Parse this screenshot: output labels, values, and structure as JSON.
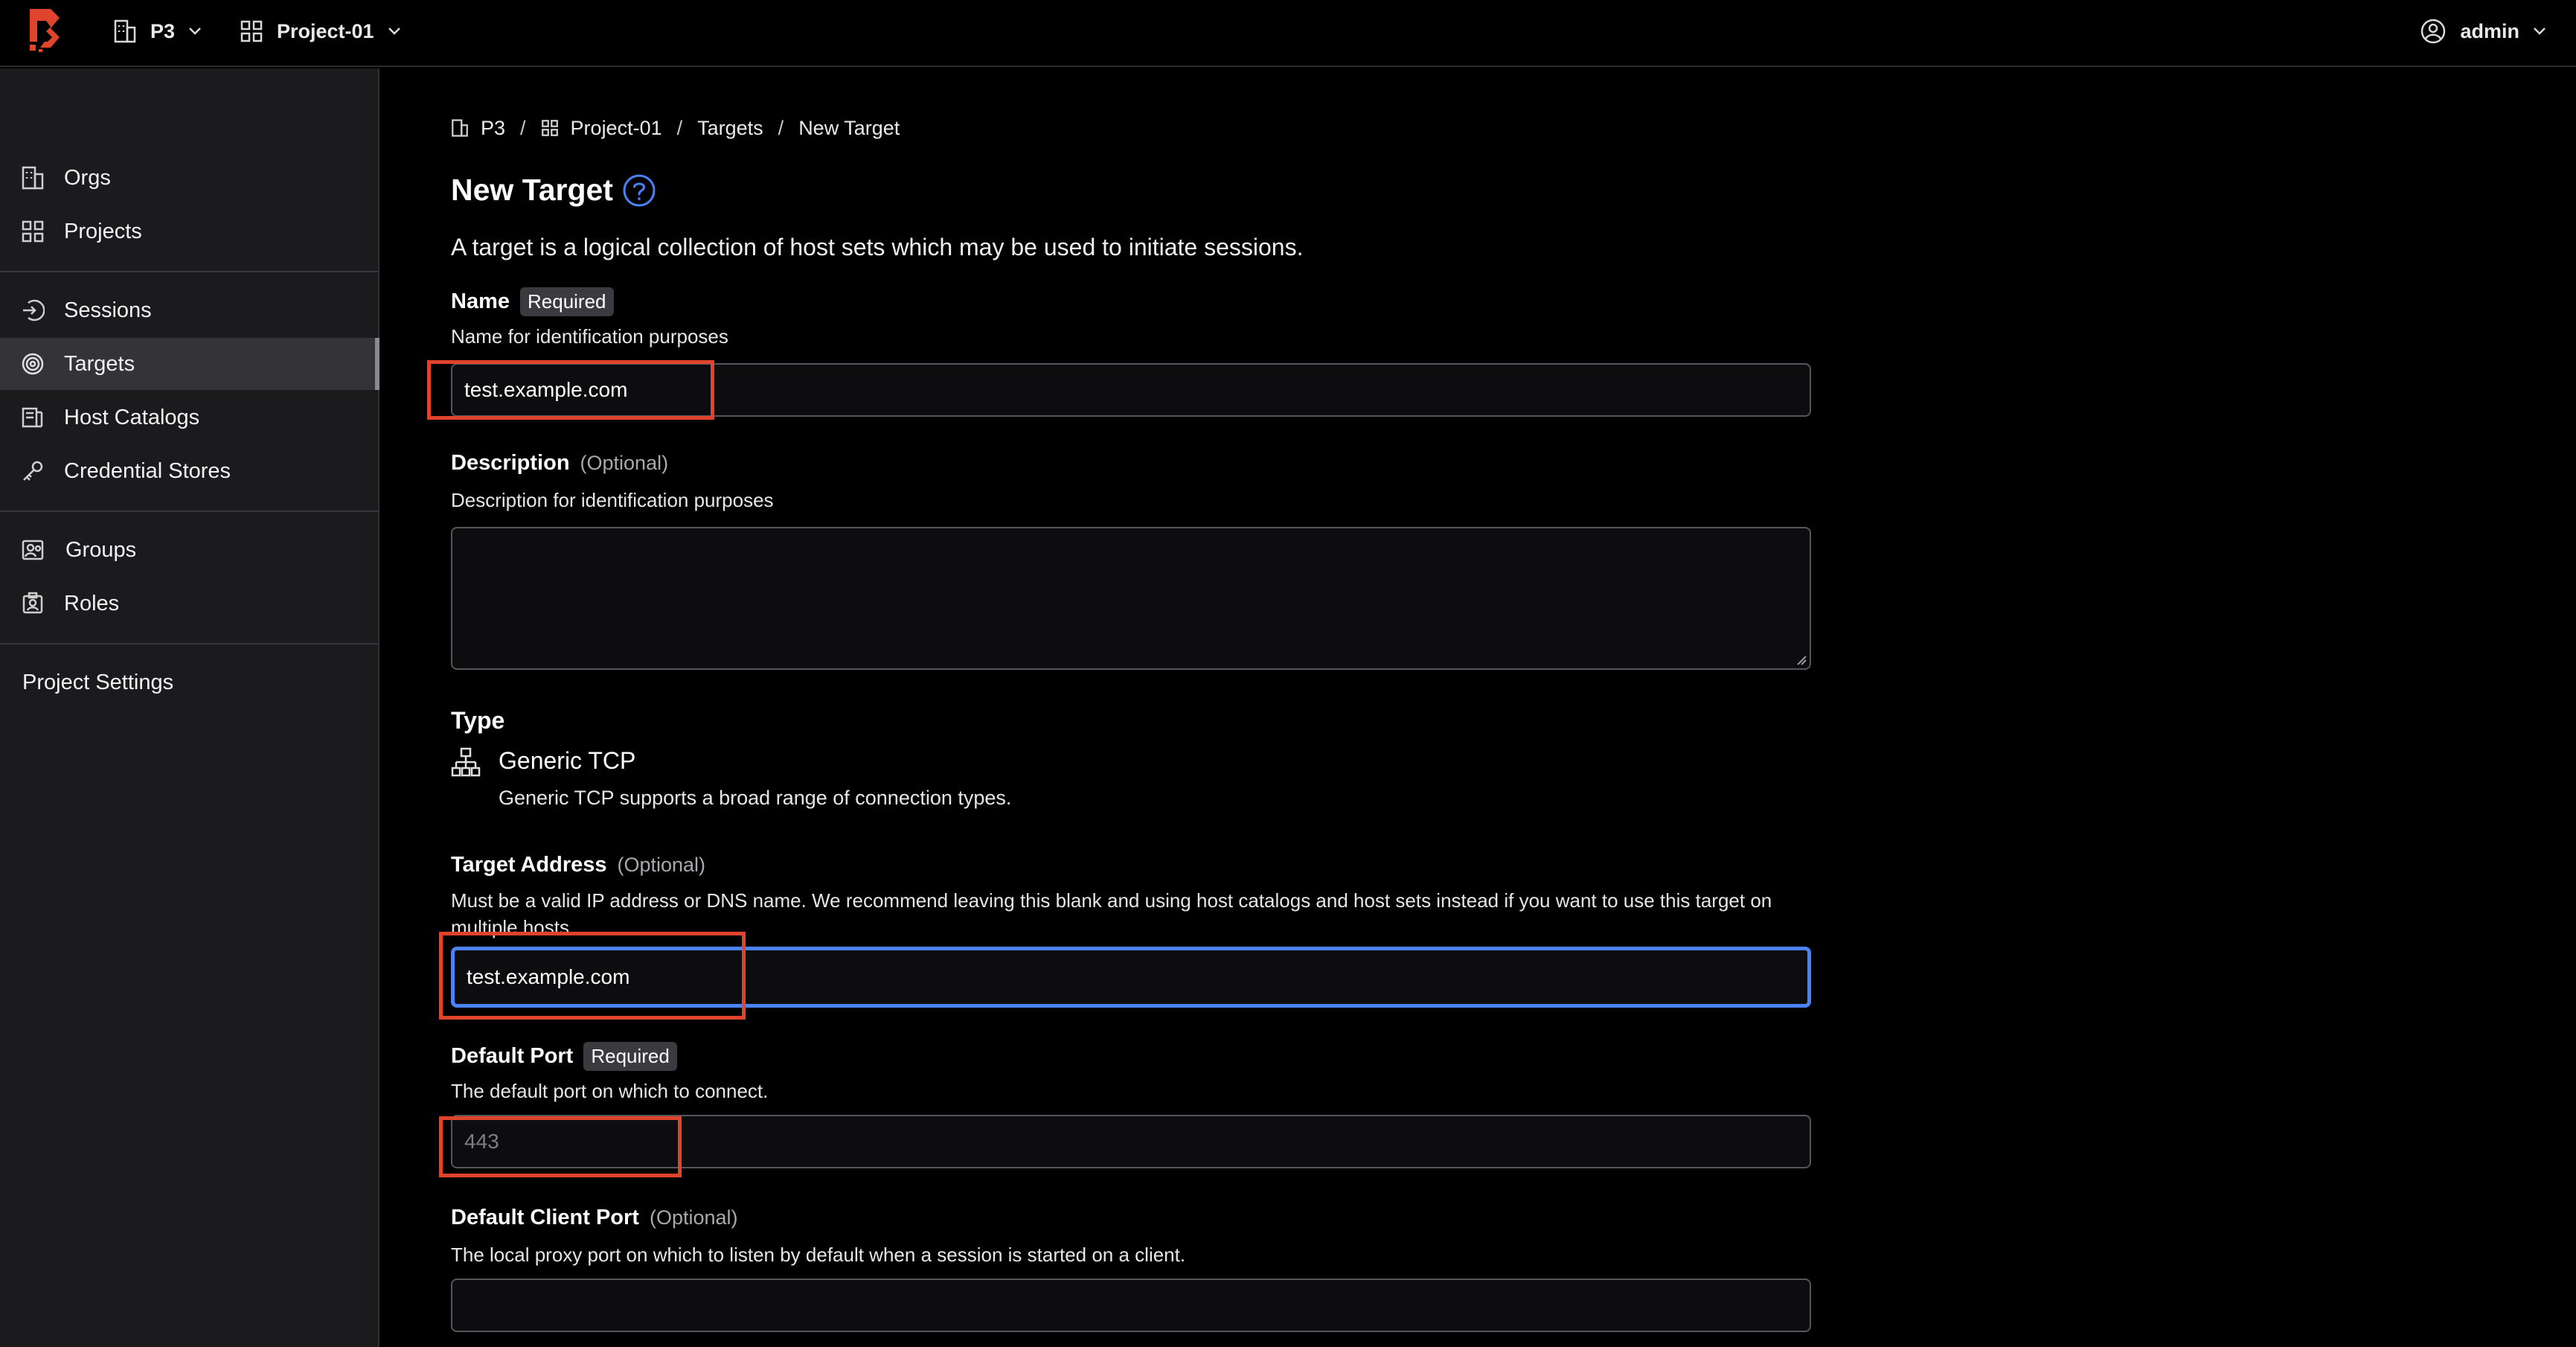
{
  "topbar": {
    "org": "P3",
    "project": "Project-01",
    "user": "admin",
    "brand_color": "#e0442c"
  },
  "sidebar": {
    "items": [
      {
        "label": "Orgs",
        "icon": "building-icon"
      },
      {
        "label": "Projects",
        "icon": "grid-icon"
      },
      {
        "label": "Sessions",
        "icon": "session-icon"
      },
      {
        "label": "Targets",
        "icon": "target-icon",
        "active": true
      },
      {
        "label": "Host Catalogs",
        "icon": "host-catalog-icon"
      },
      {
        "label": "Credential Stores",
        "icon": "key-icon"
      },
      {
        "label": "Groups",
        "icon": "groups-icon"
      },
      {
        "label": "Roles",
        "icon": "roles-icon"
      }
    ],
    "settings_label": "Project Settings"
  },
  "breadcrumb": {
    "org": "P3",
    "project": "Project-01",
    "section": "Targets",
    "current": "New Target",
    "separator": "/"
  },
  "page": {
    "title": "New Target",
    "description": "A target is a logical collection of host sets which may be used to initiate sessions."
  },
  "form": {
    "name": {
      "label": "Name",
      "badge": "Required",
      "help": "Name for identification purposes",
      "value": "test.example.com"
    },
    "description": {
      "label": "Description",
      "optional": "(Optional)",
      "help": "Description for identification purposes",
      "value": ""
    },
    "type": {
      "label": "Type",
      "name": "Generic TCP",
      "description": "Generic TCP supports a broad range of connection types."
    },
    "target_address": {
      "label": "Target Address",
      "optional": "(Optional)",
      "help": "Must be a valid IP address or DNS name. We recommend leaving this blank and using host catalogs and host sets instead if you want to use this target on multiple hosts.",
      "value": "test.example.com"
    },
    "default_port": {
      "label": "Default Port",
      "badge": "Required",
      "help": "The default port on which to connect.",
      "placeholder": "443"
    },
    "default_client_port": {
      "label": "Default Client Port",
      "optional": "(Optional)",
      "help": "The local proxy port on which to listen by default when a session is started on a client.",
      "value": ""
    }
  },
  "colors": {
    "highlight": "#e0442c",
    "focus": "#4a83f5",
    "help_icon": "#4a83f5"
  }
}
